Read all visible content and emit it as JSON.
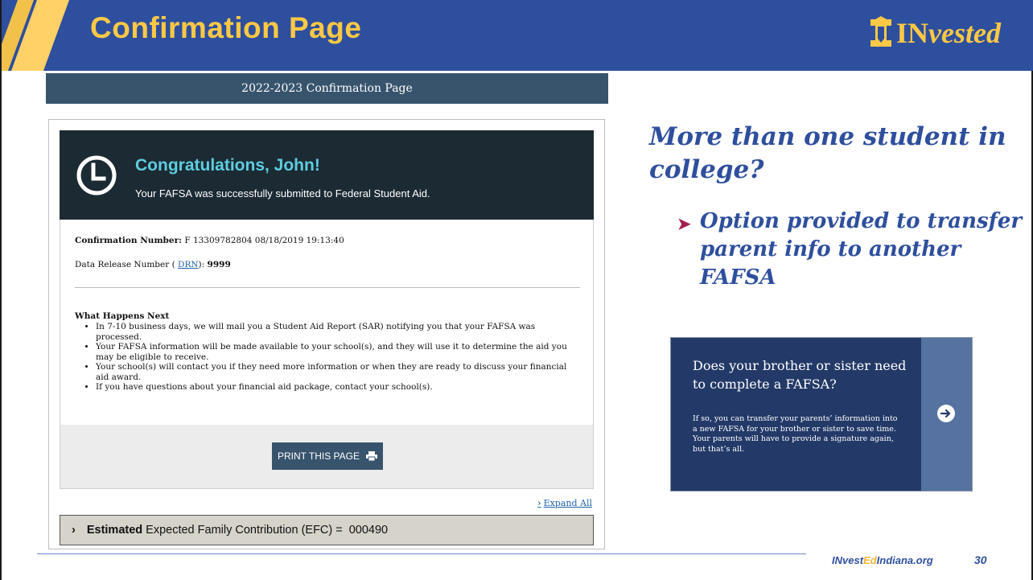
{
  "slide": {
    "title": "Confirmation Page",
    "logo": {
      "prefix": "IN",
      "suffix": "vested"
    },
    "headline": "More than one student in college?",
    "bullet": "Option provided to transfer parent info to another FAFSA",
    "footer": {
      "url_prefix": "INvest",
      "url_ed": "Ed",
      "url_suffix": "Indiana.org",
      "page_number": "30"
    },
    "colors": {
      "brand_blue": "#2e4f9d",
      "brand_gold": "#ffc845",
      "bullet_arrow": "#a31f4a"
    }
  },
  "confirmation": {
    "bar_title": "2022-2023 Confirmation Page",
    "congrats_title": "Congratulations, John!",
    "congrats_sub": "Your FAFSA was successfully submitted to Federal Student Aid.",
    "confirmation_label": "Confirmation Number:",
    "confirmation_value": " F 13309782804 08/18/2019 19:13:40",
    "drn_prefix": "Data Release Number ( ",
    "drn_link": "DRN",
    "drn_suffix": "): ",
    "drn_value": "9999",
    "next_title": "What Happens Next",
    "next_items": [
      "In 7-10 business days, we will mail you a Student Aid Report (SAR) notifying you that your FAFSA was processed.",
      "Your FAFSA information will be made available to your school(s), and they will use it to determine the aid you may be eligible to receive.",
      "Your school(s) will contact you if they need more information or when they are ready to discuss your financial aid award.",
      "If you have questions about your financial aid package, contact your school(s)."
    ],
    "print_label": "PRINT THIS PAGE",
    "expand_all": "Expand All",
    "efc_bold": "Estimated",
    "efc_label": "Expected Family Contribution (EFC) =",
    "efc_value": "000490"
  },
  "sibling_card": {
    "title": "Does your brother or sister need to complete a FAFSA?",
    "body": "If so, you can transfer your parents’ information into a new FAFSA for your brother or sister to save time.  Your parents will have to provide a signature again, but that’s all."
  },
  "icons": [
    "clock-icon",
    "printer-icon",
    "chevron-right-icon",
    "arrow-right-circle-icon",
    "indiana-logo-icon"
  ]
}
